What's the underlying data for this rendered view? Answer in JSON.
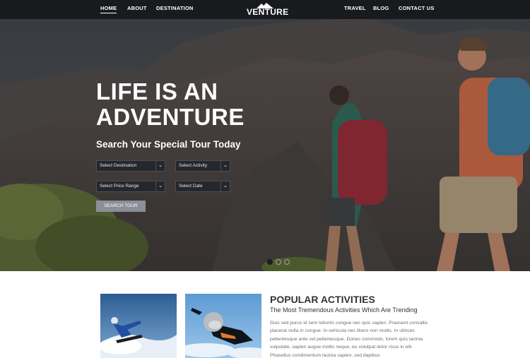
{
  "nav": {
    "home": "HOME",
    "about": "ABOUT",
    "destination": "DESTINATION",
    "logo": "VENTURE",
    "travel": "TRAVEL",
    "blog": "BLOG",
    "contact": "CONTACT US"
  },
  "hero": {
    "title_line1": "LIFE IS AN",
    "title_line2": "ADVENTURE",
    "subtitle": "Search Your Special Tour Today",
    "selects": {
      "destination": "Select Destination",
      "activity": "Select Activity",
      "price": "Select Price Range",
      "date": "Select Date"
    },
    "search_button": "SEARCH TOUR",
    "slides": {
      "count": 3,
      "active": 1
    }
  },
  "activities": {
    "title": "POPULAR ACTIVITIES",
    "subtitle": "The Most Tremendous Activities Which Are Trending",
    "body": "Duis sed purus id sem lobortis congue nec quis sapien. Praesent convallis placerat nulla in congue. In vehicula nec libero non mollis. In ultrices pellentesque ante vel pellentesque. Donec commodo, lorem quis lacinia vulputate, sapien augue mollis neque, eu volutpat dolor risus in elit. Phasellus condimentum lacinia sapien, sed dapibus"
  },
  "icons": {
    "caret": "chevron-down-icon",
    "logo_mark": "mountain-icon"
  }
}
